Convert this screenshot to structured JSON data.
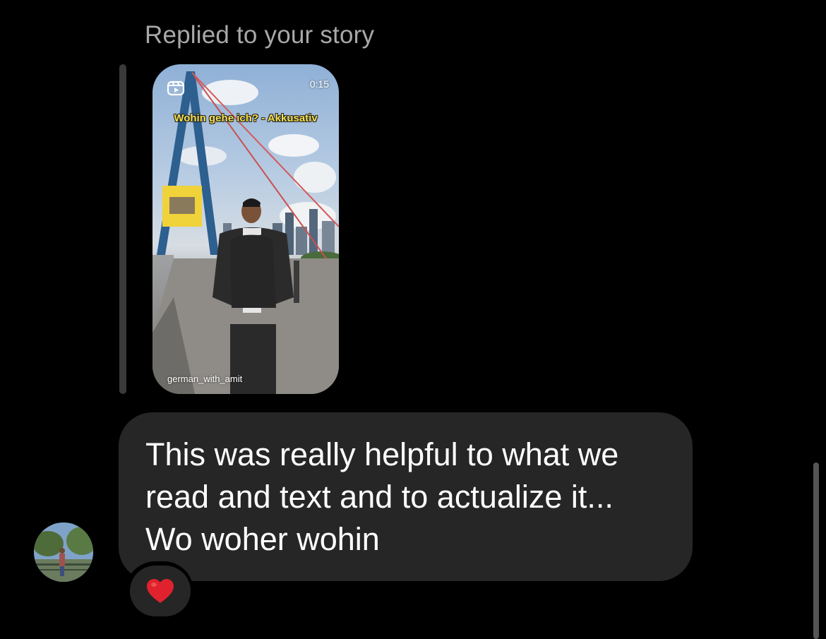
{
  "thread": {
    "reply_label": "Replied to your story"
  },
  "story": {
    "duration": "0:15",
    "caption": "Wohin gehe ich? - Akkusativ",
    "username": "german_with_amit",
    "reel_icon": "reel-icon"
  },
  "message": {
    "text": "This was really helpful to what we\nread and text and to actualize it...\nWo woher wohin",
    "reaction": "❤️",
    "reaction_icon": "heart-icon"
  },
  "colors": {
    "background": "#000000",
    "bubble": "#262626",
    "reply_label": "#a8a8a8",
    "caption": "#f4e04d",
    "reaction_heart": "#e0222e"
  }
}
